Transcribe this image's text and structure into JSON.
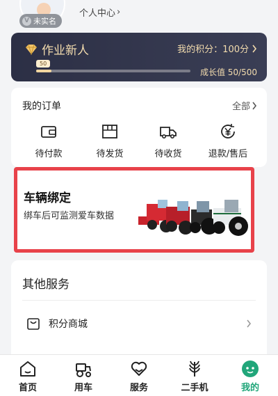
{
  "header": {
    "realname_badge": "未实名",
    "center_link": "个人中心",
    "center_chevron": "›"
  },
  "member": {
    "title": "作业新人",
    "points_text": "我的积分：100分",
    "level": "50",
    "growth_text": "成长值 50/500",
    "progress_fraction": 0.1
  },
  "orders": {
    "title": "我的订单",
    "all_label": "全部",
    "items": [
      {
        "label": "待付款",
        "icon": "wallet-icon"
      },
      {
        "label": "待发货",
        "icon": "package-icon"
      },
      {
        "label": "待收货",
        "icon": "delivery-truck-icon"
      },
      {
        "label": "退款/售后",
        "icon": "refund-yen-icon"
      }
    ]
  },
  "vehicle": {
    "title": "车辆绑定",
    "subtitle": "绑车后可监测爱车数据",
    "image": "agricultural-machines-image"
  },
  "services": {
    "title": "其他服务",
    "items": [
      {
        "label": "积分商城",
        "icon": "shopping-bag-icon"
      }
    ]
  },
  "tabbar": {
    "items": [
      {
        "label": "首页",
        "icon": "home-icon"
      },
      {
        "label": "用车",
        "icon": "tractor-icon"
      },
      {
        "label": "服务",
        "icon": "heart-hands-icon"
      },
      {
        "label": "二手机",
        "icon": "wheat-icon"
      },
      {
        "label": "我的",
        "icon": "profile-face-icon"
      }
    ],
    "active_index": 4
  },
  "colors": {
    "accent": "#21a67a",
    "card_dark": "#2c2f45",
    "gold": "#f3dcae",
    "highlight_border": "#e8424a"
  }
}
